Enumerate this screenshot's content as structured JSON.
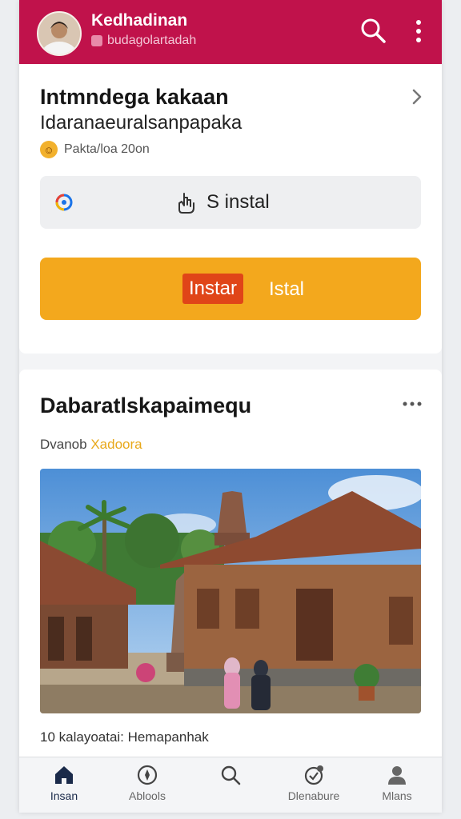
{
  "header": {
    "name": "Kedhadinan",
    "subtitle": "budagolartadah"
  },
  "card1": {
    "title": "Intmndega kakaan",
    "subtitle": "Idaranaeuralsanpapaka",
    "meta": "Pakta/loa 20on",
    "secondary_button": "S instal",
    "primary_button_tag": "Instar",
    "primary_button_rest": "Istal"
  },
  "card2": {
    "title": "Dabaratlskapaimequ",
    "meta_prefix": "Dvanob",
    "meta_accent": "Xadoora",
    "caption": "10 kalayoatai: Hemapanhak"
  },
  "nav": {
    "items": [
      {
        "label": "Insan",
        "icon": "home-icon",
        "active": true
      },
      {
        "label": "Ablools",
        "icon": "compass-icon",
        "active": false
      },
      {
        "label": "",
        "icon": "search-icon",
        "active": false
      },
      {
        "label": "Dlenabure",
        "icon": "activity-icon",
        "active": false
      },
      {
        "label": "Mlans",
        "icon": "profile-icon",
        "active": false
      }
    ]
  },
  "colors": {
    "header": "#c0124b",
    "primary_button": "#f3a81d",
    "primary_tag": "#e04518",
    "accent_text": "#e8a81a"
  }
}
